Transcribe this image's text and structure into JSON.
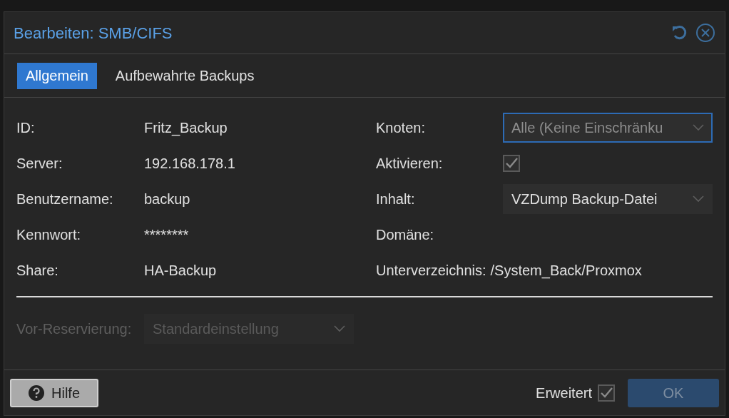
{
  "window": {
    "title": "Bearbeiten: SMB/CIFS"
  },
  "tabs": [
    {
      "label": "Allgemein",
      "selected": true
    },
    {
      "label": "Aufbewahrte Backups",
      "selected": false
    }
  ],
  "left_fields": [
    {
      "label": "ID:",
      "value": "Fritz_Backup"
    },
    {
      "label": "Server:",
      "value": "192.168.178.1"
    },
    {
      "label": "Benutzername:",
      "value": "backup"
    },
    {
      "label": "Kennwort:",
      "value": "********"
    },
    {
      "label": "Share:",
      "value": "HA-Backup"
    }
  ],
  "right_fields": [
    {
      "kind": "select",
      "label": "Knoten:",
      "value": "Alle (Keine Einschränku",
      "focused": true
    },
    {
      "kind": "checkbox",
      "label": "Aktivieren:",
      "checked": true
    },
    {
      "kind": "select",
      "label": "Inhalt:",
      "value": "VZDump Backup-Datei",
      "focused": false
    },
    {
      "kind": "text",
      "label": "Domäne:"
    },
    {
      "kind": "inline",
      "label": "Unterverzeichnis:",
      "value": "/System_Back/Proxmox"
    }
  ],
  "advanced_fields": [
    {
      "label": "Vor-Reservierung:",
      "value": "Standardeinstellung",
      "disabled": true
    }
  ],
  "footer": {
    "help_button": "Hilfe",
    "advanced": {
      "label": "Erweitert",
      "checked": true
    },
    "ok_button": {
      "label": "OK",
      "disabled": true
    }
  }
}
